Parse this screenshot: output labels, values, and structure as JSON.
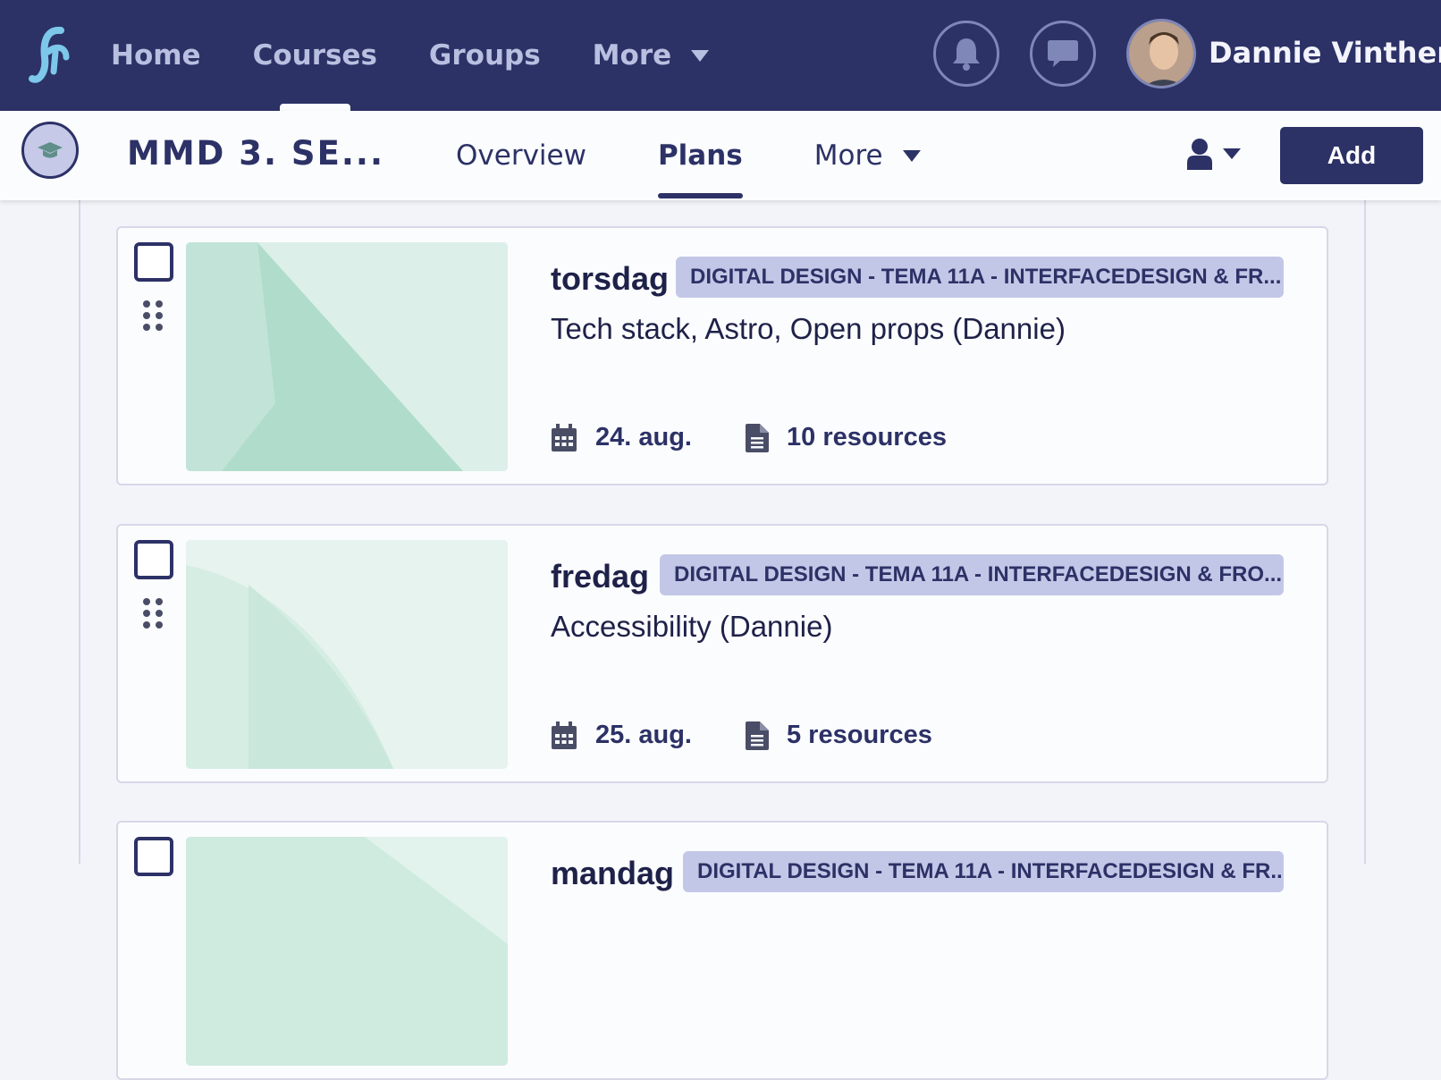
{
  "topnav": {
    "items": [
      {
        "label": "Home"
      },
      {
        "label": "Courses"
      },
      {
        "label": "Groups"
      },
      {
        "label": "More"
      }
    ],
    "user_name": "Dannie Vinther"
  },
  "course": {
    "title": "MMD 3. SE...",
    "tabs": [
      {
        "label": "Overview"
      },
      {
        "label": "Plans"
      },
      {
        "label": "More"
      }
    ],
    "add_label": "Add"
  },
  "plans": [
    {
      "day": "torsdag",
      "tag": "DIGITAL DESIGN - TEMA 11A - INTERFACEDESIGN & FR...",
      "title": "Tech stack, Astro, Open props (Dannie)",
      "date": "24. aug.",
      "resources": "10 resources"
    },
    {
      "day": "fredag",
      "tag": "DIGITAL DESIGN - TEMA 11A - INTERFACEDESIGN & FRO...",
      "title": "Accessibility (Dannie)",
      "date": "25. aug.",
      "resources": "5 resources"
    },
    {
      "day": "mandag",
      "tag": "DIGITAL DESIGN - TEMA 11A - INTERFACEDESIGN & FR..."
    }
  ],
  "colors": {
    "brand_navy": "#2c3166",
    "tag_bg": "#c3c7e7",
    "thumb_green": "#d3ece4"
  }
}
